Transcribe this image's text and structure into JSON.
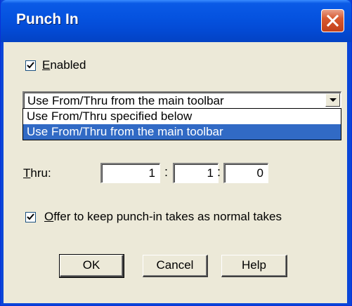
{
  "dialog": {
    "title": "Punch In",
    "close_icon": "close-x-icon"
  },
  "enabled": {
    "checked": true,
    "label": "Enabled"
  },
  "source_combo": {
    "selected": "Use From/Thru from the main toolbar",
    "options": [
      "Use From/Thru specified below",
      "Use From/Thru from the main toolbar"
    ],
    "highlighted_index": 1
  },
  "thru": {
    "label": "Thru:",
    "bar": "1",
    "beat": "1",
    "tick": "0",
    "separator": ":"
  },
  "offer_keep": {
    "checked": true,
    "label": "Offer to keep punch-in takes as normal takes"
  },
  "buttons": {
    "ok": "OK",
    "cancel": "Cancel",
    "help": "Help"
  },
  "colors": {
    "title_bar": "#0553e0",
    "close_button": "#d8592f",
    "dialog_face": "#ece9d8",
    "selection": "#316ac5"
  }
}
